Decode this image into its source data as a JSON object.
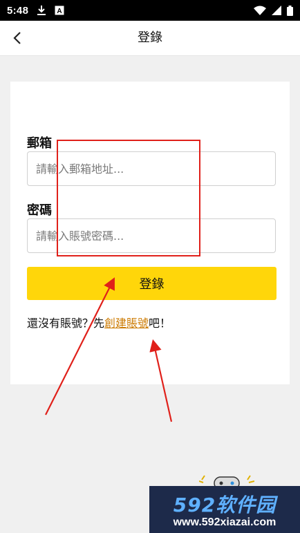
{
  "status_bar": {
    "time": "5:48",
    "icons": [
      "download-icon",
      "a-notification-icon",
      "wifi-icon",
      "signal-icon",
      "battery-icon"
    ]
  },
  "app_bar": {
    "back_icon": "chevron-left-icon",
    "title": "登錄"
  },
  "form": {
    "email_label": "郵箱",
    "email_placeholder": "請輸入郵箱地址...",
    "email_value": "",
    "password_label": "密碼",
    "password_placeholder": "請輸入賬號密碼...",
    "password_value": "",
    "login_button": "登錄",
    "register_prefix": "還沒有賬號？先",
    "register_link": "創建賬號",
    "register_suffix": "吧！"
  },
  "colors": {
    "accent": "#ffd60a",
    "link": "#cc7a00",
    "annotation": "#e0201a",
    "background": "#f0f0f0"
  },
  "watermark": {
    "title": "592软件园",
    "url": "www.592xiazai.com"
  }
}
